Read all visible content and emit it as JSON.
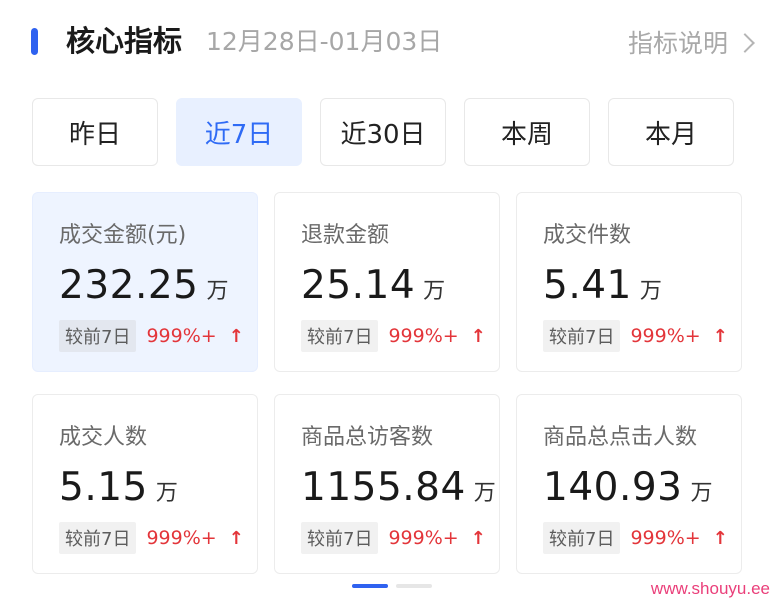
{
  "header": {
    "title": "核心指标",
    "date_range": "12月28日-01月03日",
    "help_label": "指标说明"
  },
  "tabs": [
    {
      "label": "昨日",
      "active": false
    },
    {
      "label": "近7日",
      "active": true
    },
    {
      "label": "近30日",
      "active": false
    },
    {
      "label": "本周",
      "active": false
    },
    {
      "label": "本月",
      "active": false
    }
  ],
  "cards": [
    {
      "title": "成交金额(元)",
      "value": "232.25",
      "unit": "万",
      "compare_label": "较前7日",
      "compare_value": "999%+",
      "trend_icon": "↑",
      "active": true
    },
    {
      "title": "退款金额",
      "value": "25.14",
      "unit": "万",
      "compare_label": "较前7日",
      "compare_value": "999%+",
      "trend_icon": "↑",
      "active": false
    },
    {
      "title": "成交件数",
      "value": "5.41",
      "unit": "万",
      "compare_label": "较前7日",
      "compare_value": "999%+",
      "trend_icon": "↑",
      "active": false
    },
    {
      "title": "成交人数",
      "value": "5.15",
      "unit": "万",
      "compare_label": "较前7日",
      "compare_value": "999%+",
      "trend_icon": "↑",
      "active": false
    },
    {
      "title": "商品总访客数",
      "value": "1155.84",
      "unit": "万",
      "compare_label": "较前7日",
      "compare_value": "999%+",
      "trend_icon": "↑",
      "active": false
    },
    {
      "title": "商品总点击人数",
      "value": "140.93",
      "unit": "万",
      "compare_label": "较前7日",
      "compare_value": "999%+",
      "trend_icon": "↑",
      "active": false
    }
  ],
  "colors": {
    "accent": "#2f62f0",
    "tab_active_bg": "#e8f0ff",
    "card_active_bg": "#eef4ff",
    "trend_up": "#e3353a",
    "watermark": "#ea3f7a"
  },
  "watermark": "www.shouyu.ee"
}
